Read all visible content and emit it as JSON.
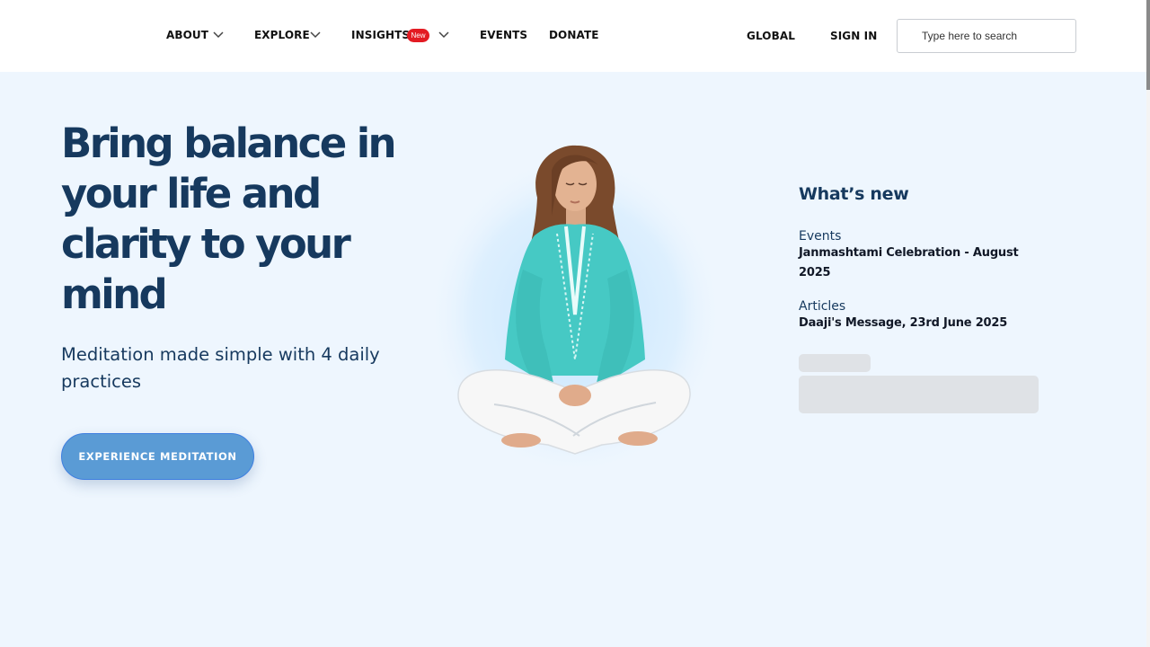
{
  "header": {
    "nav": [
      {
        "label": "ABOUT"
      },
      {
        "label": "EXPLORE"
      },
      {
        "label": "INSIGHTS",
        "badge": "New"
      },
      {
        "label": "EVENTS"
      },
      {
        "label": "DONATE"
      }
    ],
    "global_label": "GLOBAL",
    "signin_label": "SIGN IN",
    "search": {
      "placeholder": "Type here to search"
    }
  },
  "hero": {
    "title": "Bring balance in your life and clarity to your mind",
    "subtitle": "Meditation made simple with 4 daily practices",
    "cta_label": "EXPERIENCE MEDITATION"
  },
  "whats_new": {
    "title": "What’s new",
    "items": [
      {
        "category": "Events",
        "title": "Janmashtami Celebration - August 2025"
      },
      {
        "category": "Articles",
        "title": "Daaji's Message, 23rd June 2025"
      }
    ]
  },
  "colors": {
    "background": "#eef6fe",
    "heading": "#16395e",
    "cta": "#5a9bd5",
    "badge": "#e31b23"
  }
}
